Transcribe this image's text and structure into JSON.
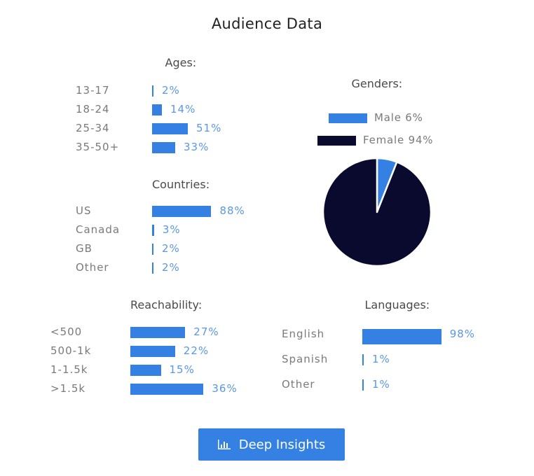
{
  "header": {
    "title": "Audience Data"
  },
  "colors": {
    "bar": "#3480e3",
    "value_text": "#5a97e6",
    "female": "#0a0a2e",
    "male": "#3480e3"
  },
  "ages": {
    "title": "Ages:",
    "rows": [
      {
        "label": "13-17",
        "value": 2,
        "text": "2%"
      },
      {
        "label": "18-24",
        "value": 14,
        "text": "14%"
      },
      {
        "label": "25-34",
        "value": 51,
        "text": "51%"
      },
      {
        "label": "35-50+",
        "value": 33,
        "text": "33%"
      }
    ]
  },
  "countries": {
    "title": "Countries:",
    "rows": [
      {
        "label": "US",
        "value": 88,
        "text": "88%"
      },
      {
        "label": "Canada",
        "value": 3,
        "text": "3%"
      },
      {
        "label": "GB",
        "value": 2,
        "text": "2%"
      },
      {
        "label": "Other",
        "value": 2,
        "text": "2%"
      }
    ]
  },
  "genders": {
    "title": "Genders:",
    "legend": [
      {
        "label": "Male 6%",
        "value": 6,
        "color": "#3480e3"
      },
      {
        "label": "Female 94%",
        "value": 94,
        "color": "#0a0a2e"
      }
    ]
  },
  "reachability": {
    "title": "Reachability:",
    "rows": [
      {
        "label": "<500",
        "value": 27,
        "text": "27%"
      },
      {
        "label": "500-1k",
        "value": 22,
        "text": "22%"
      },
      {
        "label": "1-1.5k",
        "value": 15,
        "text": "15%"
      },
      {
        "label": ">1.5k",
        "value": 36,
        "text": "36%"
      }
    ]
  },
  "languages": {
    "title": "Languages:",
    "rows": [
      {
        "label": "English",
        "value": 98,
        "text": "98%"
      },
      {
        "label": "Spanish",
        "value": 1,
        "text": "1%"
      },
      {
        "label": "Other",
        "value": 1,
        "text": "1%"
      }
    ]
  },
  "button": {
    "label": "Deep Insights",
    "icon": "bar-chart-icon"
  },
  "chart_data": [
    {
      "type": "bar",
      "title": "Ages:",
      "categories": [
        "13-17",
        "18-24",
        "25-34",
        "35-50+"
      ],
      "values": [
        2,
        14,
        51,
        33
      ],
      "unit": "%"
    },
    {
      "type": "bar",
      "title": "Countries:",
      "categories": [
        "US",
        "Canada",
        "GB",
        "Other"
      ],
      "values": [
        88,
        3,
        2,
        2
      ],
      "unit": "%"
    },
    {
      "type": "pie",
      "title": "Genders:",
      "categories": [
        "Male",
        "Female"
      ],
      "values": [
        6,
        94
      ],
      "legend": "top"
    },
    {
      "type": "bar",
      "title": "Reachability:",
      "categories": [
        "<500",
        "500-1k",
        "1-1.5k",
        ">1.5k"
      ],
      "values": [
        27,
        22,
        15,
        36
      ],
      "unit": "%"
    },
    {
      "type": "bar",
      "title": "Languages:",
      "categories": [
        "English",
        "Spanish",
        "Other"
      ],
      "values": [
        98,
        1,
        1
      ],
      "unit": "%"
    }
  ]
}
